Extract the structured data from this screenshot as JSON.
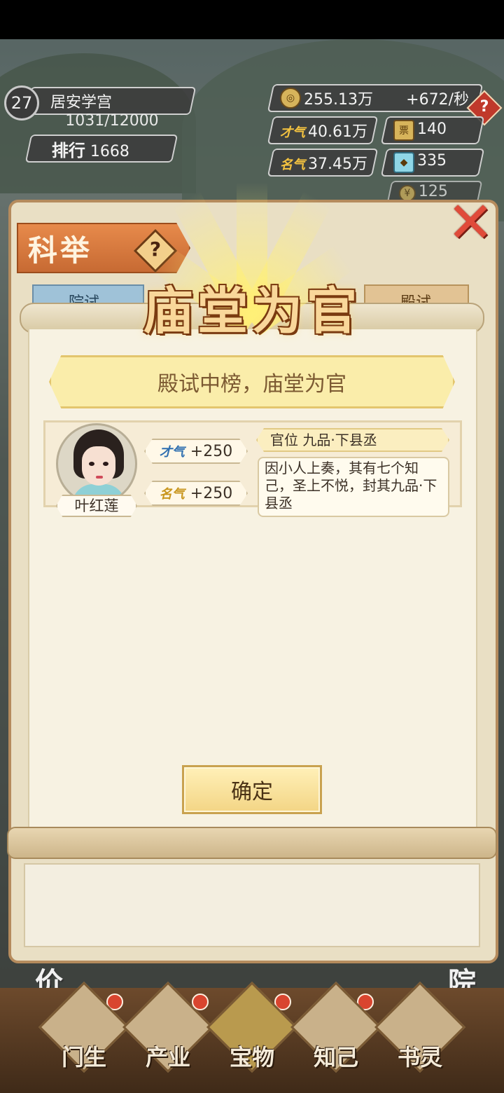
{
  "hud": {
    "level": "27",
    "academy_name": "居安学宫",
    "exp": "1031/12000",
    "rank_label": "排行",
    "rank_value": "1668",
    "coins": "255.13万",
    "coin_rate": "+672/秒",
    "talent_label": "才气",
    "talent_value": "40.61万",
    "ticket_value": "140",
    "fame_label": "名气",
    "fame_value": "37.45万",
    "gem_value": "335",
    "gold_value": "125"
  },
  "modal": {
    "section_title": "科举",
    "help_symbol": "?",
    "tab_left": "院试",
    "tab_right": "殿试",
    "title": "庙堂为官",
    "subtitle": "殿试中榜，庙堂为官",
    "student": {
      "name": "叶红莲",
      "talent_label": "才气",
      "talent_gain": "+250",
      "fame_label": "名气",
      "fame_gain": "+250",
      "rank": "官位 九品·下县丞",
      "description": "因小人上奏，其有七个知己，圣上不悦，封其九品·下县丞"
    },
    "confirm_label": "确定"
  },
  "bottom_nav": {
    "items": [
      "门生",
      "产业",
      "宝物",
      "知己",
      "书灵"
    ]
  },
  "side_chars": {
    "left": "价",
    "right": "院"
  }
}
